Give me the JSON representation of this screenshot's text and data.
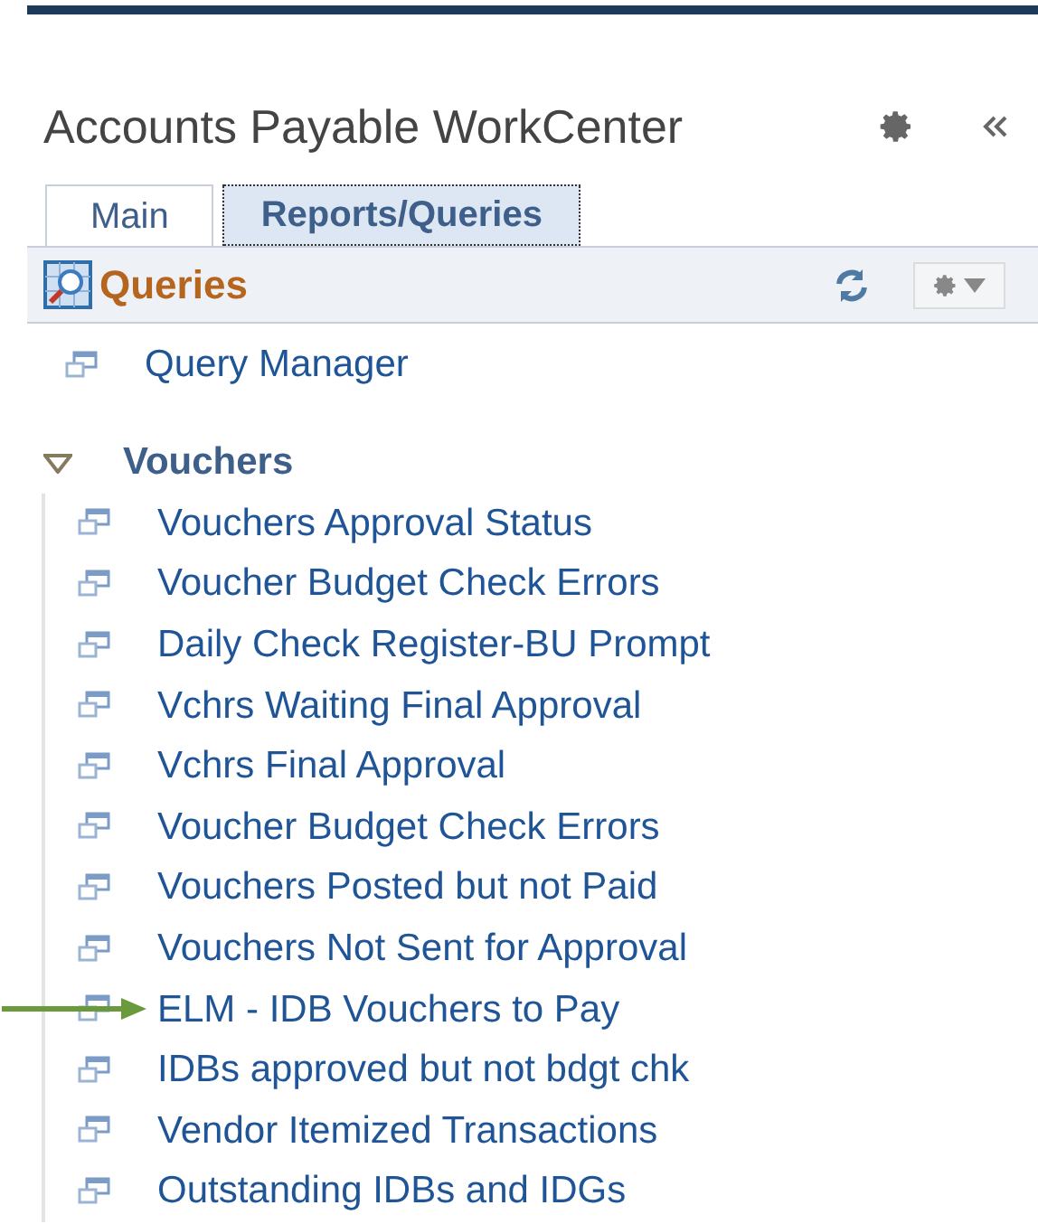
{
  "header": {
    "title": "Accounts Payable WorkCenter"
  },
  "tabs": [
    {
      "label": "Main",
      "selected": false
    },
    {
      "label": "Reports/Queries",
      "selected": true
    }
  ],
  "section": {
    "title": "Queries"
  },
  "top_links": [
    {
      "label": "Query Manager",
      "marked": false
    }
  ],
  "groups": [
    {
      "label": "Vouchers",
      "expanded": true,
      "items": [
        {
          "label": "Vouchers Approval Status",
          "marked": false
        },
        {
          "label": "Voucher Budget Check Errors",
          "marked": false
        },
        {
          "label": "Daily Check Register-BU Prompt",
          "marked": false
        },
        {
          "label": "Vchrs Waiting Final Approval",
          "marked": false
        },
        {
          "label": "Vchrs Final Approval",
          "marked": false
        },
        {
          "label": "Voucher Budget Check Errors",
          "marked": false
        },
        {
          "label": "Vouchers Posted but not Paid",
          "marked": false
        },
        {
          "label": "Vouchers Not Sent for Approval",
          "marked": false
        },
        {
          "label": "ELM - IDB Vouchers to Pay",
          "marked": true
        },
        {
          "label": "IDBs approved but not bdgt chk",
          "marked": false
        },
        {
          "label": "Vendor Itemized Transactions",
          "marked": false
        },
        {
          "label": "Outstanding IDBs and IDGs",
          "marked": false
        }
      ]
    }
  ]
}
